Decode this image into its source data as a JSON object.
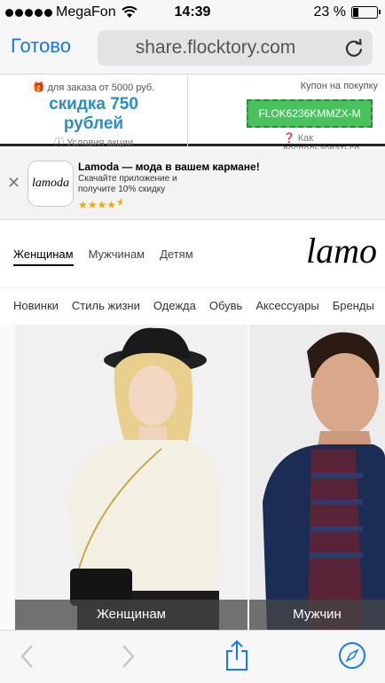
{
  "status_bar": {
    "carrier": "MegaFon",
    "time": "14:39",
    "battery": "23 %",
    "battery_level": 0.23
  },
  "safari_bar": {
    "done_label": "Готово",
    "url": "share.flocktory.com"
  },
  "coupon_banner": {
    "condition": "для заказа от 5000 руб.",
    "discount_line1": "скидка 750",
    "discount_line2": "рублей",
    "terms_link": "Условия акции",
    "coupon_title": "Купон на покупку",
    "coupon_code": "FLOK6236KMMZX-M",
    "howto_link": "Как воспользоваться"
  },
  "app_banner": {
    "title": "Lamoda — мода в вашем кармане!",
    "desc_line1": "Скачайте приложение и",
    "desc_line2": "получите 10% скидку",
    "icon_text": "lamoda",
    "rating": 4.5,
    "rating_max": 5
  },
  "site_header": {
    "gender_tabs": [
      "Женщинам",
      "Мужчинам",
      "Детям"
    ],
    "logo_visible": "lamo"
  },
  "category_nav": [
    "Новинки",
    "Стиль жизни",
    "Одежда",
    "Обувь",
    "Аксессуары",
    "Бренды"
  ],
  "promo_cards": {
    "women_label": "Женщинам",
    "men_label": "Мужчин"
  },
  "colors": {
    "ios_blue": "#1478f6",
    "discount_blue": "#2a8fc9",
    "coupon_green": "#49c25d"
  }
}
